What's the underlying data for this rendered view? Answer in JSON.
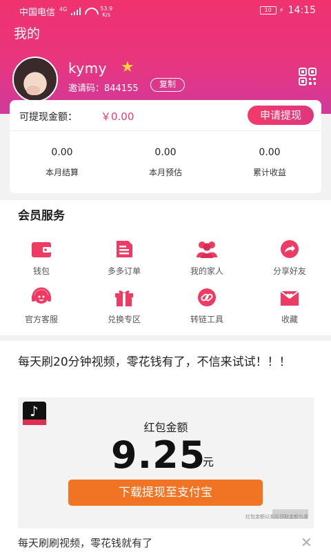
{
  "status_bar": {
    "carrier": "中国电信",
    "network": "4G",
    "speed_value": "53.9",
    "speed_unit": "K/s",
    "battery": "10",
    "time": "14:15"
  },
  "header": {
    "title": "我的"
  },
  "profile": {
    "username": "kymy",
    "invite_label": "邀请码：",
    "invite_code": "844155",
    "copy_label": "复制"
  },
  "earnings": {
    "withdrawable_label": "可提现金额：",
    "withdrawable_amount": "￥0.00",
    "withdraw_button": "申请提现",
    "stats": [
      {
        "value": "0.00",
        "label": "本月结算"
      },
      {
        "value": "0.00",
        "label": "本月预估"
      },
      {
        "value": "0.00",
        "label": "累计收益"
      }
    ]
  },
  "services": {
    "title": "会员服务",
    "items": [
      {
        "label": "钱包",
        "icon": "wallet-icon"
      },
      {
        "label": "多多订单",
        "icon": "order-icon"
      },
      {
        "label": "我的家人",
        "icon": "family-icon"
      },
      {
        "label": "分享好友",
        "icon": "share-icon"
      },
      {
        "label": "官方客服",
        "icon": "headset-icon"
      },
      {
        "label": "兑换专区",
        "icon": "gift-icon"
      },
      {
        "label": "转链工具",
        "icon": "link-icon"
      },
      {
        "label": "收藏",
        "icon": "favorite-icon"
      }
    ]
  },
  "ad": {
    "headline": "每天刷20分钟视频，零花钱有了，不信来试试！！！",
    "red_packet_title": "红包金额",
    "red_packet_amount": "9.25",
    "red_packet_unit": "元",
    "download_button": "下载提现至支付宝",
    "disclaimer": "红包金额以实际领取金额为准",
    "subtitle": "每天刷刷视频，零花钱就有了"
  },
  "colors": {
    "brand_pink": "#f0326e",
    "accent_orange": "#f07424",
    "star_yellow": "#ffd43b"
  }
}
